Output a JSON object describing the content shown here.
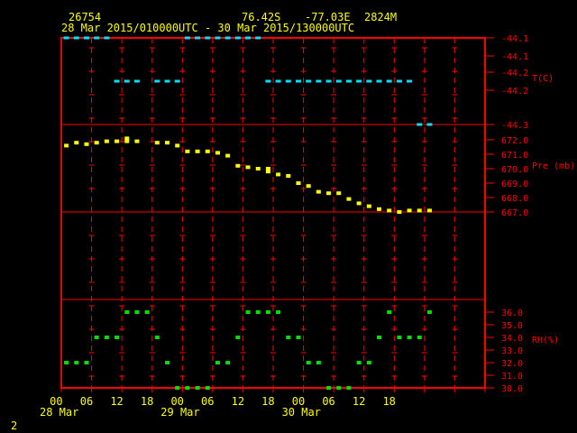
{
  "header": {
    "station": "26754",
    "lat": "76.42S",
    "lon": "-77.03E",
    "elev": "2824M",
    "period": "28 Mar 2015/010000UTC - 30 Mar 2015/130000UTC"
  },
  "corner_label": "2",
  "colors": {
    "frame": "#ff0000",
    "header": "#ffff00",
    "temp": "#00e0ff",
    "pressure": "#ffff00",
    "rh": "#00e000",
    "axis": "#ffff00",
    "right_axis": "#ff0000"
  },
  "chart_data": [
    {
      "type": "scatter",
      "panel": "temperature",
      "ylabel": "T(C)",
      "yticks": [
        "-44.1",
        "-44.1",
        "-44.2",
        "-44.2",
        "-44.3"
      ],
      "ylim": [
        -44.3,
        -44.1
      ],
      "series": [
        {
          "x": [
            1,
            3,
            5,
            7,
            9,
            25,
            27,
            29,
            31,
            33,
            35,
            37,
            39,
            11,
            13,
            15,
            19,
            21,
            23,
            41,
            43,
            45,
            47,
            49,
            51,
            53,
            55,
            57,
            59,
            61,
            63,
            65,
            67,
            69,
            71,
            73
          ],
          "y": [
            -44.1,
            -44.1,
            -44.1,
            -44.1,
            -44.1,
            -44.1,
            -44.1,
            -44.1,
            -44.1,
            -44.1,
            -44.1,
            -44.1,
            -44.1,
            -44.2,
            -44.2,
            -44.2,
            -44.2,
            -44.2,
            -44.2,
            -44.2,
            -44.2,
            -44.2,
            -44.2,
            -44.2,
            -44.2,
            -44.2,
            -44.2,
            -44.2,
            -44.2,
            -44.2,
            -44.2,
            -44.2,
            -44.2,
            -44.2,
            -44.3,
            -44.3
          ]
        }
      ]
    },
    {
      "type": "scatter",
      "panel": "pressure",
      "ylabel": "Pre (mb)",
      "yticks": [
        "672.0",
        "671.0",
        "670.0",
        "669.0",
        "668.0",
        "667.0"
      ],
      "ylim": [
        667.0,
        672.0
      ],
      "series": [
        {
          "x": [
            1,
            3,
            5,
            7,
            9,
            11,
            13,
            13,
            15,
            19,
            21,
            23,
            25,
            27,
            29,
            31,
            33,
            35,
            37,
            39,
            41,
            41,
            43,
            45,
            47,
            49,
            51,
            53,
            55,
            57,
            59,
            61,
            63,
            65,
            67,
            69,
            71,
            73
          ],
          "y": [
            671.6,
            671.8,
            671.7,
            671.8,
            671.9,
            671.9,
            672.1,
            671.9,
            671.9,
            671.8,
            671.8,
            671.6,
            671.2,
            671.2,
            671.2,
            671.1,
            670.9,
            670.2,
            670.1,
            670.0,
            670.0,
            669.8,
            669.6,
            669.5,
            669.0,
            668.8,
            668.4,
            668.3,
            668.3,
            667.9,
            667.6,
            667.4,
            667.2,
            667.1,
            667.0,
            667.1,
            667.1,
            667.1
          ]
        }
      ]
    },
    {
      "type": "scatter",
      "panel": "relative_humidity",
      "ylabel": "RH(%)",
      "yticks": [
        "36.0",
        "35.0",
        "34.0",
        "33.0",
        "32.0",
        "31.0",
        "30.0"
      ],
      "ylim": [
        30.0,
        36.0
      ],
      "series": [
        {
          "x": [
            1,
            3,
            5,
            7,
            9,
            11,
            13,
            15,
            17,
            19,
            21,
            23,
            25,
            27,
            29,
            31,
            33,
            35,
            37,
            39,
            41,
            43,
            45,
            47,
            49,
            51,
            53,
            55,
            57,
            59,
            61,
            63,
            65,
            67,
            69,
            71,
            73
          ],
          "y": [
            32,
            32,
            32,
            34,
            34,
            34,
            36,
            36,
            36,
            34,
            32,
            30,
            30,
            30,
            30,
            32,
            32,
            34,
            36,
            36,
            36,
            36,
            34,
            34,
            32,
            32,
            30,
            30,
            30,
            32,
            32,
            34,
            36,
            34,
            34,
            34,
            36
          ]
        }
      ]
    }
  ],
  "x_axis": {
    "hour_labels": [
      "00",
      "06",
      "12",
      "18",
      "00",
      "06",
      "12",
      "18",
      "00",
      "06",
      "12",
      "18"
    ],
    "date_labels": [
      "28 Mar",
      "29 Mar",
      "30 Mar"
    ]
  }
}
